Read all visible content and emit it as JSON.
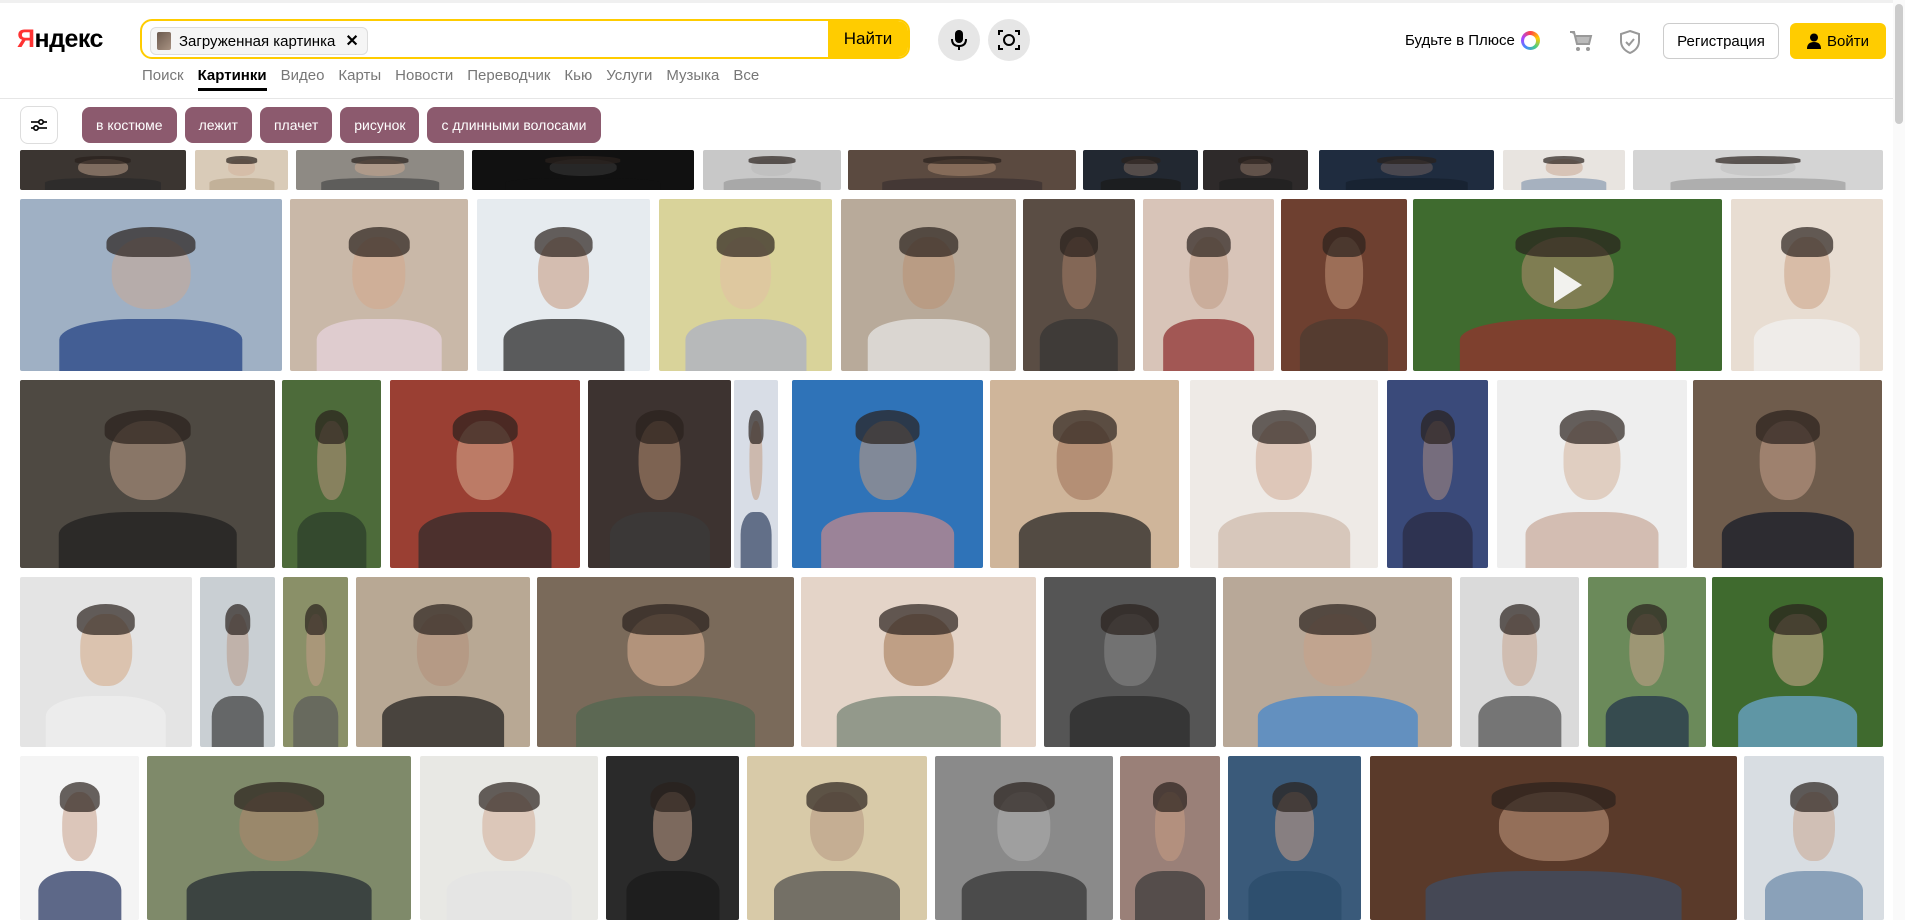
{
  "brand": {
    "logo_first": "Я",
    "logo_rest": "ндекс"
  },
  "search": {
    "chip_label": "Загруженная картинка",
    "chip_close": "✕",
    "submit": "Найти"
  },
  "tabs": [
    {
      "label": "Поиск",
      "active": false
    },
    {
      "label": "Картинки",
      "active": true
    },
    {
      "label": "Видео",
      "active": false
    },
    {
      "label": "Карты",
      "active": false
    },
    {
      "label": "Новости",
      "active": false
    },
    {
      "label": "Переводчик",
      "active": false
    },
    {
      "label": "Кью",
      "active": false
    },
    {
      "label": "Услуги",
      "active": false
    },
    {
      "label": "Музыка",
      "active": false
    },
    {
      "label": "Все",
      "active": false
    }
  ],
  "header_right": {
    "plus_text": "Будьте в Плюсе",
    "register": "Регистрация",
    "login": "Войти"
  },
  "filters": [
    "в костюме",
    "лежит",
    "плачет",
    "рисунок",
    "с длинными волосами"
  ],
  "colors": {
    "accent": "#ffcc00",
    "pill": "#8c5a6e"
  },
  "results": {
    "row_partial": [
      {
        "bg": "#3b3531",
        "skin": "#b89a86",
        "shirt": "#2a2a2a"
      },
      {
        "bg": "#d9cbb8",
        "skin": "#d2b39b",
        "shirt": "#b8a58c"
      },
      {
        "bg": "#8e8a84",
        "skin": "#c9a790",
        "shirt": "#4a4a4a"
      },
      {
        "bg": "#111111",
        "skin": "#3a3a3a",
        "shirt": "#111111"
      },
      {
        "bg": "#c8c8c8",
        "skin": "#b9b9b9",
        "shirt": "#9a9a9a"
      },
      {
        "bg": "#5b4a40",
        "skin": "#a8866e",
        "shirt": "#3a3030"
      },
      {
        "bg": "#222831",
        "skin": "#7d6a5e",
        "shirt": "#1a1a1a"
      },
      {
        "bg": "#2e2a2a",
        "skin": "#8c7364",
        "shirt": "#1f1f1f"
      },
      {
        "bg": "#1f2c3f",
        "skin": "#6b5f5c",
        "shirt": "#15202e"
      },
      {
        "bg": "#e8e4e0",
        "skin": "#c9a894",
        "shirt": "#8a9bb0"
      },
      {
        "bg": "#d4d4d4",
        "skin": "#bdbdbd",
        "shirt": "#9e9e9e"
      }
    ],
    "row1": [
      {
        "bg": "#9fb0c4",
        "skin": "#c9a996",
        "shirt": "#1d3c80"
      },
      {
        "bg": "#c9b8a8",
        "skin": "#d3a88a",
        "shirt": "#e8d4e0"
      },
      {
        "bg": "#e6ebef",
        "skin": "#c4977c",
        "shirt": "#1e1e1e"
      },
      {
        "bg": "#d9d39a",
        "skin": "#e2c0a4",
        "shirt": "#a8aec8"
      },
      {
        "bg": "#b8aa9a",
        "skin": "#b98f72",
        "shirt": "#e8e8e8"
      },
      {
        "bg": "#5a4d44",
        "skin": "#a57e66",
        "shirt": "#333333"
      },
      {
        "bg": "#d8c4b8",
        "skin": "#c09a84",
        "shirt": "#8c2a2a"
      },
      {
        "bg": "#6e4030",
        "skin": "#c29478",
        "shirt": "#4a3a30"
      },
      {
        "bg": "#3f6b2f",
        "skin": "#b48c70",
        "shirt": "#9a2e2e",
        "video": true
      },
      {
        "bg": "#e8ddd2",
        "skin": "#caa083",
        "shirt": "#f2f2f2"
      }
    ],
    "row2": [
      {
        "bg": "#4e4942",
        "skin": "#b99a86",
        "shirt": "#1e1e1e"
      },
      {
        "bg": "#4d6b3a",
        "skin": "#b8937c",
        "shirt": "#2a3a2a"
      },
      {
        "bg": "#9a3f33",
        "skin": "#d8ad90",
        "shirt": "#2b2b2b"
      },
      {
        "bg": "#3d3330",
        "skin": "#b38a70",
        "shirt": "#3a3a3a"
      },
      {
        "bg": "#d8dde6",
        "skin": "#c29a80",
        "shirt": "#304060"
      },
      {
        "bg": "#2f73b8",
        "skin": "#c59a7e",
        "shirt": "#c98a8a"
      },
      {
        "bg": "#cfb59a",
        "skin": "#9e7058",
        "shirt": "#1e1e1e"
      },
      {
        "bg": "#eeeae6",
        "skin": "#d1aa93",
        "shirt": "#cdb8a8"
      },
      {
        "bg": "#3a4a7a",
        "skin": "#a88a80",
        "shirt": "#2a2a40"
      },
      {
        "bg": "#eeeeee",
        "skin": "#d6b49c",
        "shirt": "#c8a898"
      },
      {
        "bg": "#6f5c4c",
        "skin": "#c4a08a",
        "shirt": "#111827"
      }
    ],
    "row3": [
      {
        "bg": "#e4e4e4",
        "skin": "#d4a784",
        "shirt": "#f0f0f0"
      },
      {
        "bg": "#c9cfd3",
        "skin": "#b89a88",
        "shirt": "#3a3a3a"
      },
      {
        "bg": "#8a9068",
        "skin": "#c29c86",
        "shirt": "#5a5a5a"
      },
      {
        "bg": "#b8a894",
        "skin": "#b38e78",
        "shirt": "#1a1a1a"
      },
      {
        "bg": "#7a6a5a",
        "skin": "#e0b498",
        "shirt": "#506850"
      },
      {
        "bg": "#e4d4c8",
        "skin": "#a0724e",
        "shirt": "#708070"
      },
      {
        "bg": "#555555",
        "skin": "#8a8a8a",
        "shirt": "#2a2a2a"
      },
      {
        "bg": "#b8a898",
        "skin": "#c8a088",
        "shirt": "#3f86d0"
      },
      {
        "bg": "#dadada",
        "skin": "#c9a590",
        "shirt": "#4a4a4a"
      },
      {
        "bg": "#6b8a5a",
        "skin": "#c6a08a",
        "shirt": "#20304a"
      },
      {
        "bg": "#3f6a2e",
        "skin": "#d0aa90",
        "shirt": "#6eaad8"
      }
    ],
    "row4": [
      {
        "bg": "#f4f4f4",
        "skin": "#c8a08a",
        "shirt": "#1c2c5a"
      },
      {
        "bg": "#7f8a6a",
        "skin": "#b0866c",
        "shirt": "#202630"
      },
      {
        "bg": "#e8e8e4",
        "skin": "#d2ac96",
        "shirt": "#e4e4e4"
      },
      {
        "bg": "#2a2a2a",
        "skin": "#c09c86",
        "shirt": "#1a1a1a"
      },
      {
        "bg": "#d8caa8",
        "skin": "#b79882",
        "shirt": "#4a4a4a"
      },
      {
        "bg": "#8a8a8a",
        "skin": "#b0b0b0",
        "shirt": "#303030"
      },
      {
        "bg": "#9a8078",
        "skin": "#c89c84",
        "shirt": "#383838"
      },
      {
        "bg": "#3a5a7a",
        "skin": "#c69e86",
        "shirt": "#2a4a6a"
      },
      {
        "bg": "#5a3a2a",
        "skin": "#c49a80",
        "shirt": "#3c4f68"
      },
      {
        "bg": "#d8dde2",
        "skin": "#caa690",
        "shirt": "#6a88a8"
      }
    ]
  }
}
